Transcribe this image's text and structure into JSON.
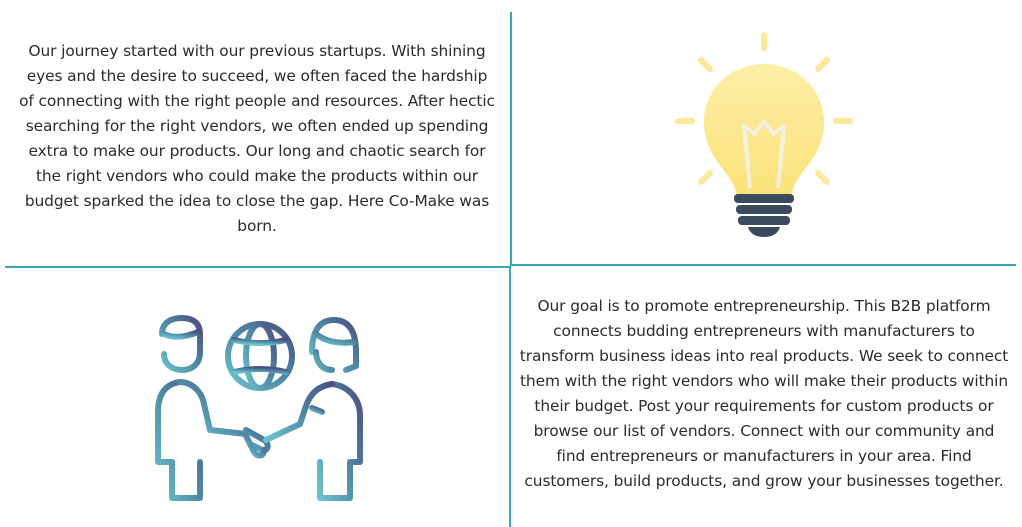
{
  "story": {
    "paragraph": "Our journey started with our previous startups. With shining eyes and the desire to succeed, we often faced the hardship of connecting with the right people and resources. After hectic searching for the right vendors, we often ended up spending extra to make our products. Our long and chaotic search for the right vendors who could make the products within our budget sparked the idea to close the gap. Here Co-Make was born."
  },
  "goal": {
    "paragraph": "Our goal is to promote entrepreneurship. This B2B platform connects budding entrepreneurs with manufacturers to transform business ideas into real products. We seek to connect them with the right vendors who will make their products within their budget. Post your requirements for custom products or browse our list of vendors. Connect with our community and find entrepreneurs or manufacturers in your area. Find customers, build products, and grow your businesses together."
  },
  "colors": {
    "divider": "#3aa7b8",
    "bulb_glow": "#fde79a",
    "bulb_base": "#3b4a5e",
    "handshake_gradient_start": "#6bc3cf",
    "handshake_gradient_end": "#4b4f83"
  },
  "icons": {
    "top_right": "lightbulb-icon",
    "bottom_left": "handshake-globe-icon"
  }
}
